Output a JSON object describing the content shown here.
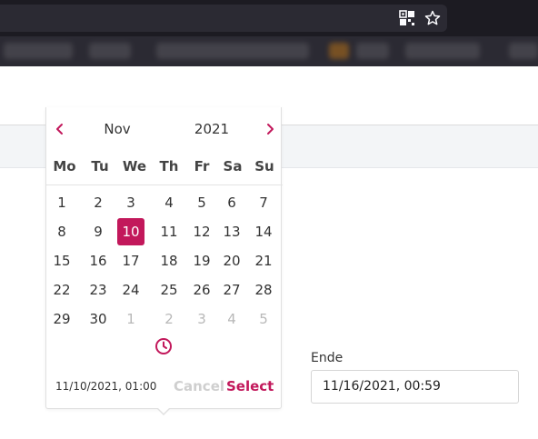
{
  "datepicker": {
    "month": "Nov",
    "year": "2021",
    "weekdays": [
      "Mo",
      "Tu",
      "We",
      "Th",
      "Fr",
      "Sa",
      "Su"
    ],
    "weeks": [
      [
        "1",
        "2",
        "3",
        "4",
        "5",
        "6",
        "7"
      ],
      [
        "8",
        "9",
        "10",
        "11",
        "12",
        "13",
        "14"
      ],
      [
        "15",
        "16",
        "17",
        "18",
        "19",
        "20",
        "21"
      ],
      [
        "22",
        "23",
        "24",
        "25",
        "26",
        "27",
        "28"
      ],
      [
        "29",
        "30",
        "1",
        "2",
        "3",
        "4",
        "5"
      ]
    ],
    "selected_day": "10",
    "selected_value": "11/10/2021, 01:00",
    "cancel_label": "Cancel",
    "select_label": "Select",
    "prev_icon": "chevron-left-icon",
    "next_icon": "chevron-right-icon",
    "time_icon": "clock-icon"
  },
  "end_field": {
    "label": "Ende",
    "value": "11/16/2021, 00:59"
  },
  "colors": {
    "accent": "#c2185b",
    "browser_chrome": "#1c1b22"
  }
}
